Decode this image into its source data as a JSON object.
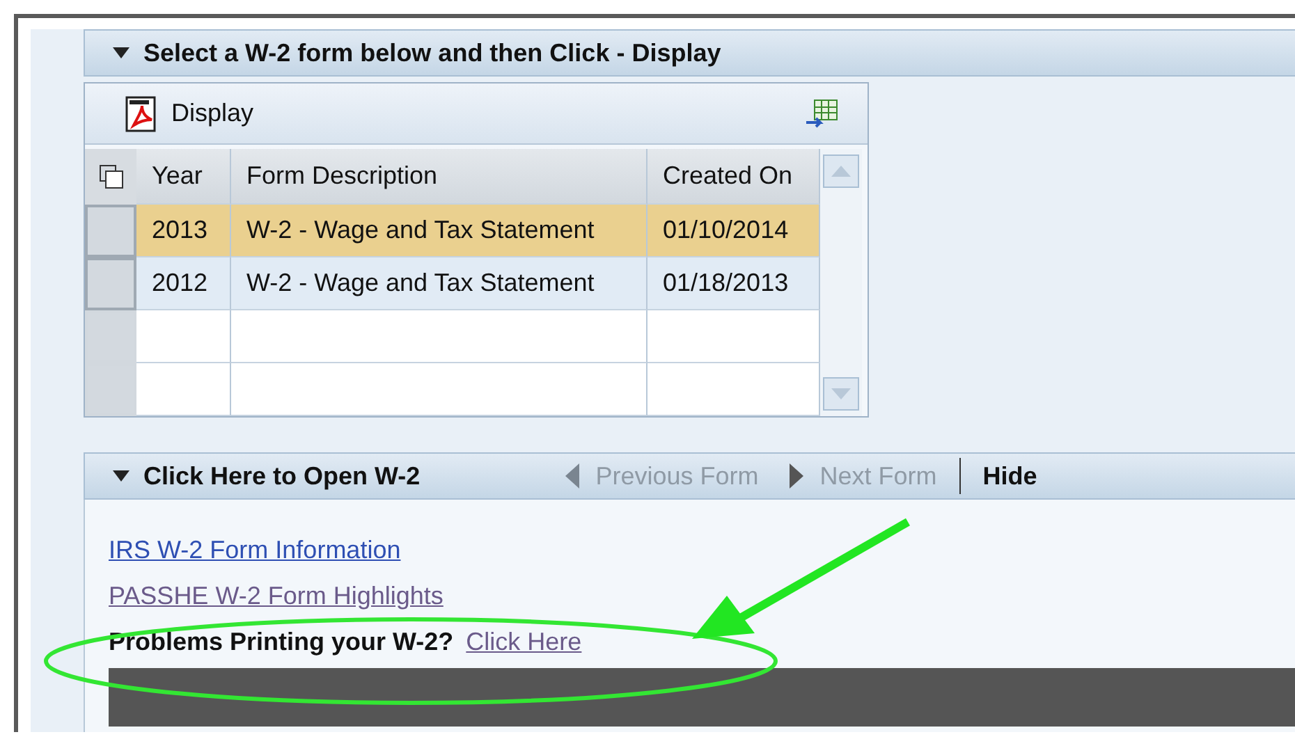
{
  "form_panel": {
    "title": "Select a W-2 form below and then Click - Display",
    "expanded": true
  },
  "toolbar": {
    "display_button": "Display"
  },
  "table": {
    "columns": [
      "Year",
      "Form Description",
      "Created On"
    ],
    "rows": [
      {
        "year": "2013",
        "description": "W-2 - Wage and Tax Statement",
        "created_on": "01/10/2014",
        "selected": true
      },
      {
        "year": "2012",
        "description": "W-2 - Wage and Tax Statement",
        "created_on": "01/18/2013",
        "selected": false
      }
    ]
  },
  "open_panel": {
    "title": "Click Here to Open W-2",
    "expanded": true,
    "previous": "Previous Form",
    "next": "Next Form",
    "hide": "Hide"
  },
  "links": [
    "IRS W-2 Form Information",
    "PASSHE W-2 Form Highlights"
  ],
  "problems": {
    "label": "Problems Printing your W-2?",
    "link": "Click Here"
  }
}
